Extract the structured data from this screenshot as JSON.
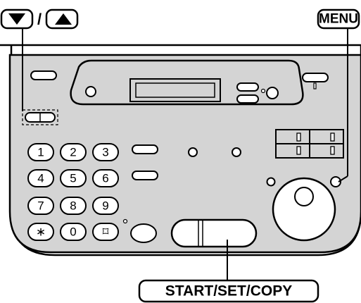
{
  "labels": {
    "arrow_separator": "/",
    "menu": "MENU",
    "start_set_copy": "START/SET/COPY"
  },
  "keypad": {
    "keys": [
      "1",
      "2",
      "3",
      "4",
      "5",
      "6",
      "7",
      "8",
      "9",
      "∗",
      "0",
      "⌑"
    ]
  },
  "icons": {
    "down": "triangle-down-icon",
    "up": "triangle-up-icon",
    "hash": "hash-icon"
  },
  "colors": {
    "panel": "#d4d4d4",
    "outline": "#000000",
    "button_fill": "#ffffff",
    "display_fill": "#d4d4d4"
  }
}
